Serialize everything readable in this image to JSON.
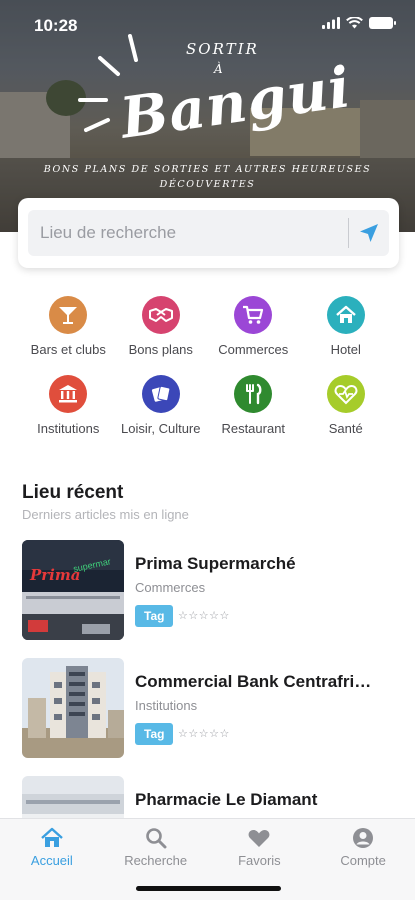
{
  "status_bar": {
    "time": "10:28"
  },
  "hero": {
    "logo_small": "SORTIR",
    "logo_a": "À",
    "logo_big": "Bangui",
    "tagline": "Bons plans de sorties et autres heureuses découvertes"
  },
  "search": {
    "placeholder": "Lieu de recherche",
    "value": "",
    "icon": "location-arrow-icon"
  },
  "categories": [
    {
      "label": "Bars et clubs",
      "icon": "cocktail-icon",
      "color": "#d98b47"
    },
    {
      "label": "Bons plans",
      "icon": "handshake-icon",
      "color": "#d6436f"
    },
    {
      "label": "Commerces",
      "icon": "cart-icon",
      "color": "#9b47d6"
    },
    {
      "label": "Hotel",
      "icon": "home-icon",
      "color": "#2bb0bd"
    },
    {
      "label": "Institutions",
      "icon": "bank-icon",
      "color": "#e04e3c"
    },
    {
      "label": "Loisir, Culture",
      "icon": "cards-icon",
      "color": "#3b47b8"
    },
    {
      "label": "Restaurant",
      "icon": "utensils-icon",
      "color": "#2f8a2f"
    },
    {
      "label": "Santé",
      "icon": "heart-pulse-icon",
      "color": "#a6cc2a"
    }
  ],
  "recent": {
    "title": "Lieu récent",
    "subtitle": "Derniers articles mis en ligne",
    "items": [
      {
        "title": "Prima Supermarché",
        "category": "Commerces",
        "tag": "Tag",
        "stars": "☆☆☆☆☆"
      },
      {
        "title": "Commercial Bank Centrafrique",
        "category": "Institutions",
        "tag": "Tag",
        "stars": "☆☆☆☆☆"
      },
      {
        "title": "Pharmacie Le Diamant",
        "category": "",
        "tag": "",
        "stars": ""
      }
    ]
  },
  "tabs": [
    {
      "label": "Accueil",
      "icon": "home-icon",
      "active": true
    },
    {
      "label": "Recherche",
      "icon": "search-icon",
      "active": false
    },
    {
      "label": "Favoris",
      "icon": "heart-icon",
      "active": false
    },
    {
      "label": "Compte",
      "icon": "user-icon",
      "active": false
    }
  ],
  "colors": {
    "accent": "#3a9fe0",
    "tag": "#58b9e6"
  }
}
